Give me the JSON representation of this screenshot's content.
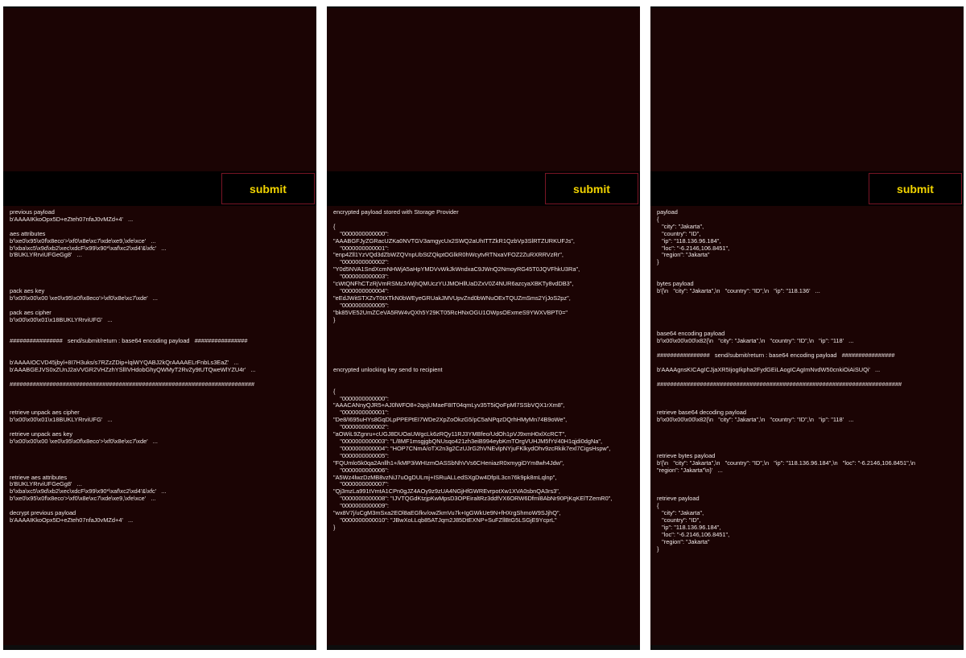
{
  "colors": {
    "panel_bg": "#1b0404",
    "bar_bg": "#000000",
    "accent_border": "#7a1525",
    "submit_text": "#f2d400",
    "output_text": "#f2e9e9"
  },
  "panels": [
    {
      "submit_label": "submit",
      "output": "previous payload\nb'AAAAIKkoOpx5D+eZteh07nfaJ0vMZd+4'   ...\n\naes attributes\nb'\\xe0\\x95\\x0f\\x8eco'>\\xf0\\x8e\\xc7\\xde\\xe9,\\xfe\\xce'   ...\nb'\\xba\\xc5\\x9d\\xb2\\xec\\xdcF\\x99\\x90*\\xaf\\xc2\\xd4'&\\xfc'   ...\nb'BUKLYRrviUFGeGg8'   ...\n\n\n\n\npack aes key\nb'\\x00\\x00\\x00 \\xe0\\x95\\x0f\\x8eco'>\\xf0\\x8e\\xc7\\xde'   ...\n\npack aes cipher\nb'\\x00\\x00\\x01\\x18BUKLYRrviUFG'   ...\n\n\n################   send/submit/return : base64 encoding payload   ################\n\n\nb'AAAAIOCVD45jbyl+8I7H3uks/s7RZzZDip+lqiWYQABJ2kQrAAAAELrFnbLs3EaZ'   ...\nb'AAABGEJVS0xZUnJ2aVVGR2VHZzhYSllIVHdobGhyQWMyT2RvZy9tUTQweWlYZU4r'   ...\n\n##########################################################################\n\n\n\nretrieve unpack aes cipher\nb'\\x00\\x00\\x01\\x18BUKLYRrviUFG'   ...\n\nretrieve unpack aes key\nb'\\x00\\x00\\x00 \\xe0\\x95\\x0f\\x8eco'>\\xf0\\x8e\\xc7\\xde'   ...\n\n\n\n\nretrieve aes attributes\nb'BUKLYRrviUFGeGg8'   ...\nb'\\xba\\xc5\\x9d\\xb2\\xec\\xdcF\\x99\\x90*\\xaf\\xc2\\xd4'&\\xfc'   ...\nb'\\xe0\\x95\\x0f\\x8eco'>\\xf0\\x8e\\xc7\\xde\\xe9,\\xfe\\xce'   ...\n\ndecrypt previous payload\nb'AAAAIKkoOpx5D+eZteh07nfaJ0vMZd+4'   ..."
    },
    {
      "submit_label": "submit",
      "output": "encrypted payload stored with Storage Provider\n\n{\n    \"0000000000000\":\n\"AAABGFJyZGRacUZKa0NVTGV3amgycUx2SWQ2aUhITTZkR1QzbVp3SlRTZURKUFJs\",\n    \"0000000000001\":\n\"enp4Zll1YzVQd3dZbWZQVnpUbStZQkptOGlkR0hWcytvRTNxaVFOZ2ZuRXRRVzRr\",\n    \"0000000000002\":\n\"Y0d5NVA1SndXcmNHWjA5aHpYMDVvWkJkWndxaC9JWnQ2NmoyRG45T0JQVFhkU3Ra\",\n    \"0000000000003\":\n\"cWtQNFhCTzRjVmRSMzJrWjhQMUczYUJMOHllUaDZxV0Z4NUR6azcyaXBKTy8vdDB3\",\n    \"0000000000004\":\n\"eEdJWitSTXZvT0tXTkN0bWEyeGRUakJMVUpvZnd0bWNuOExTQUZmSms2YjJoS2pz\",\n    \"0000000000005\":\n\"bk85VE52UmZCeVA5RW4vQXh5Y29KT05RcHNxOGU1OWpsOExmeS9YWXVBPT0=\"\n}\n\n\n\n\n\n\nencrypted unlocking key send to recipient\n\n\n{\n    \"0000000000000\":\n\"AAACANnyQJR5+AJ0lWFO8+2qojUMaeF8IT04qmLyv35T5iQoFpMl7SSbVQX1rXm8\",\n    \"0000000000001\":\n\"De8/I695uHYs8GqDLpPPEPtEI7WDe2XpZoOkzG5/pC5aNPqzDQrhHMyMn74B9oWe\",\n    \"0000000000002\":\n\"aOWiL9Zgnru+cUGJ8DUOaUWgcLk6zRQy11RJ3YMBfeo/UdOh1pVJ9xmH0xlXcRCT\",\n    \"0000000000003\": \"L/8MF1msgjgbQNUsqo421zh3eiB994eybKmTOrgVUHJM5fYt/40H1qjdi0dgNa\",\n    \"0000000000004\": \"HOP7CNmA/oTX2n3g2CzUJrG2hVNEvlpNYjuFKlkydOhv9zcRkik7exl7CigsHspw\",\n    \"0000000000005\":\n\"FQUmlo5k0qa2Anllh1+/kMP3iWHIzmOASSbNhVVs6CHeniazR0xmygiDYm8wh4Jdw\",\n    \"0000000000006\":\n\"A5Wz4lwzDzMB8vzNiJ7uOgDULmj+ISRuALLedSXgDw4DfpIL3cn76k9pk8mLqlnp\",\n    \"0000000000007\":\n\"Qj3mzLa991tVmtA1CPn0gJZ4AOy9z9zUA4NGjHfGWREvrpotXw1XVA0sbnQA3rs3\",\n    \"0000000000008\": \"IJVTQGdKtzjpKwMpsD3OPEiraltRz3ddfVX6ORW6Dfml8AbNr90PjKqKElTZemR0\",\n    \"0000000000009\":\n\"wx8V7j/uCgM3mSxa2EOl8aEGfkv/owZkmVu7k+IgGWkUe9N+fHXrgShmoW9SJjhQ\",\n    \"0000000000010\": \"JBwXoLLqb85ATJqm2J85DtEXNP+SuFZllBtG5LSGjE9YcprL\"\n}"
    },
    {
      "submit_label": "submit",
      "output": "payload\n{\n   \"city\": \"Jakarta\",\n   \"country\": \"ID\",\n   \"ip\": \"118.136.96.184\",\n   \"loc\": \"-6.2146,106.8451\",\n   \"region\": \"Jakarta\"\n}\n\n\nbytes payload\nb'{\\n   \"city\": \"Jakarta\",\\n   \"country\": \"ID\",\\n   \"ip\": \"118.136'   ...\n\n\n\n\n\nbase64 encoding payload\nb'\\x00\\x00\\x00\\x82{\\n   \"city\": \"Jakarta\",\\n   \"country\": \"ID\",\\n   \"ip\": \"118'   ...\n\n################   send/submit/return : base64 encoding payload   ################\n\nb'AAAAgnsKICAgICJjaXR5IjogIkpha2FydGEiLAogICAgImNvdW50cnkiOiAiSUQi'   ...\n\n##########################################################################\n\n\n\nretrieve base64 decoding payload\nb'\\x00\\x00\\x00\\x82{\\n   \"city\": \"Jakarta\",\\n   \"country\": \"ID\",\\n   \"ip\": \"118'   ...\n\n\n\n\nretrieve bytes payload\nb'{\\n   \"city\": \"Jakarta\",\\n   \"country\": \"ID\",\\n   \"ip\": \"118.136.96.184\",\\n   \"loc\": \"-6.2146,106.8451\",\\n\n\"region\": \"Jakarta\"\\n}'   ...\n\n\n\nretrieve payload\n{\n   \"city\": \"Jakarta\",\n   \"country\": \"ID\",\n   \"ip\": \"118.136.96.184\",\n   \"loc\": \"-6.2146,106.8451\",\n   \"region\": \"Jakarta\"\n}"
    }
  ]
}
